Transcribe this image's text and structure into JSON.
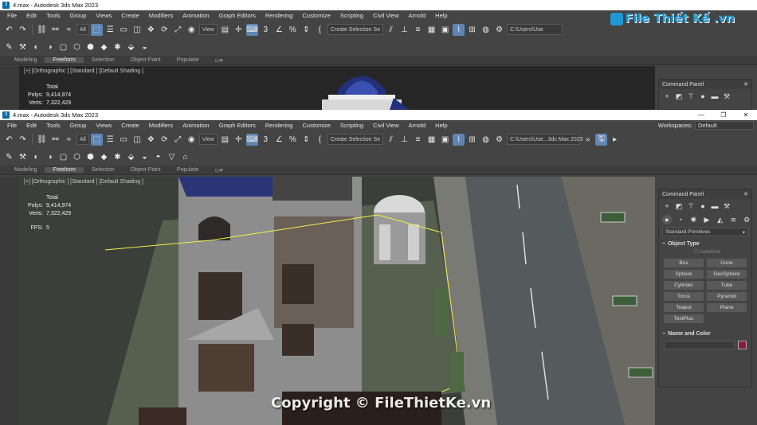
{
  "window_title": "4.max - Autodesk 3ds Max 2023",
  "window_controls": [
    "—",
    "❐",
    "✕"
  ],
  "menu": [
    "File",
    "Edit",
    "Tools",
    "Group",
    "Views",
    "Create",
    "Modifiers",
    "Animation",
    "Graph Editors",
    "Rendering",
    "Customize",
    "Scripting",
    "Civil View",
    "Arnold",
    "Help"
  ],
  "workspaces_label": "Workspaces:",
  "workspaces_value": "Default",
  "toolbar": {
    "filter_dropdown": "All",
    "view_dropdown": "View",
    "selection_set": "Create Selection Se",
    "path_field": "C:\\Users\\Use...3ds Max 2023",
    "path_field_top": "C:\\Users\\Use"
  },
  "ribbon_tabs": [
    "Modeling",
    "Freeform",
    "Selection",
    "Object Paint",
    "Populate"
  ],
  "ribbon_active": "Freeform",
  "viewport": {
    "label": "[+] [Orthographic ] [Standard ] [Default Shading ]",
    "total_label": "Total",
    "polys_label": "Polys:",
    "polys_value": "9,414,974",
    "verts_label": "Verts:",
    "verts_value": "7,322,429",
    "fps_label": "FPS:",
    "fps_value": "5"
  },
  "command_panel": {
    "title": "Command Panel",
    "category": "Standard Primitives",
    "object_type": "Object Type",
    "autogrid": "AutoGrid",
    "buttons": [
      "Box",
      "Cone",
      "Sphere",
      "GeoSphere",
      "Cylinder",
      "Tube",
      "Torus",
      "Pyramid",
      "Teapot",
      "Plane",
      "TextPlus"
    ],
    "name_and_color": "Name and Color",
    "object_color": "#8c1a3e"
  },
  "watermark_logo": "File Thiết Kế .vn",
  "copyright": "Copyright © FileThietKe.vn"
}
